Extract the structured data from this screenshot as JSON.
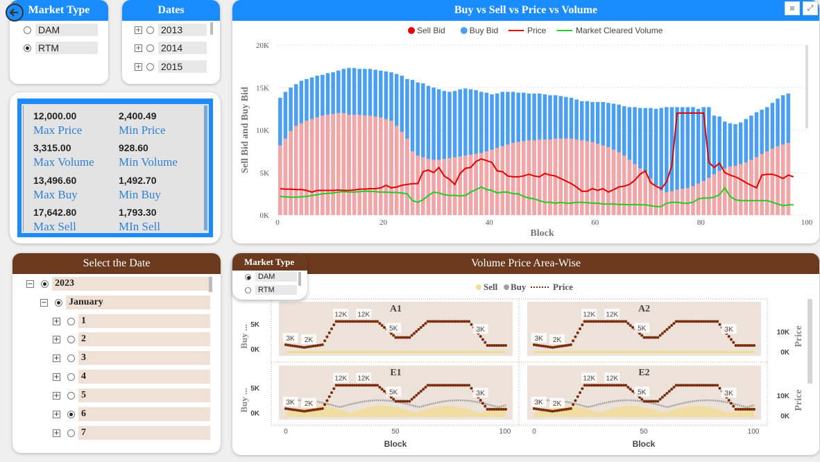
{
  "market_type_slicer": {
    "title": "Market Type",
    "options": [
      {
        "label": "DAM",
        "selected": false
      },
      {
        "label": "RTM",
        "selected": true
      }
    ]
  },
  "dates_slicer": {
    "title": "Dates",
    "options": [
      "2013",
      "2014",
      "2015"
    ]
  },
  "stats": [
    {
      "value": "12,000.00",
      "label": "Max Price"
    },
    {
      "value": "2,400.49",
      "label": "Min Price"
    },
    {
      "value": "3,315.00",
      "label": "Max Volume"
    },
    {
      "value": "928.60",
      "label": "Min Volume"
    },
    {
      "value": "13,496.60",
      "label": "Max Buy"
    },
    {
      "value": "1,492.70",
      "label": "Min Buy"
    },
    {
      "value": "17,642.80",
      "label": "Max Sell"
    },
    {
      "value": "1,793.30",
      "label": "MIn Sell"
    }
  ],
  "select_date": {
    "title": "Select the Date",
    "year": "2023",
    "month": "January",
    "days": [
      {
        "label": "1",
        "selected": false
      },
      {
        "label": "2",
        "selected": false
      },
      {
        "label": "3",
        "selected": false
      },
      {
        "label": "4",
        "selected": false
      },
      {
        "label": "5",
        "selected": false
      },
      {
        "label": "6",
        "selected": true
      },
      {
        "label": "7",
        "selected": false
      }
    ]
  },
  "main_chart_header": {
    "title": "Buy vs Sell vs Price vs Volume"
  },
  "market_type_popup": {
    "title": "Market Type",
    "options": [
      {
        "label": "DAM",
        "selected": true
      },
      {
        "label": "RTM",
        "selected": false
      }
    ]
  },
  "area_chart_header": {
    "title": "Volume Price Area-Wise"
  },
  "colors": {
    "sell": "#f4a6a6",
    "buy": "#4a9ff0",
    "price": "#e00000",
    "volume": "#22cc22",
    "blue_header": "#1a8cff",
    "brown_header": "#6b3a1e",
    "price_dots": "#7a2e10",
    "area_sell": "#efdc95",
    "area_buy": "#a0a0a0"
  },
  "chart_data": [
    {
      "type": "bar",
      "title": "Buy vs Sell vs Price vs Volume",
      "xlabel": "Block",
      "ylabel": "Sell Bid and Buy Bid",
      "xlim": [
        0,
        100
      ],
      "ylim": [
        0,
        20000
      ],
      "x_ticks": [
        "0",
        "20",
        "40",
        "60",
        "80",
        "100"
      ],
      "y_ticks": [
        "0K",
        "5K",
        "10K",
        "15K",
        "20K"
      ],
      "legend": [
        "Sell Bid",
        "Buy Bid",
        "Price",
        "Market Cleared Volume"
      ],
      "legend_position": "top",
      "buy_bid": [
        13800,
        14500,
        15000,
        15400,
        15800,
        16000,
        16200,
        16400,
        16500,
        16700,
        16800,
        17000,
        17200,
        17300,
        17300,
        17200,
        17200,
        17200,
        17100,
        17000,
        16900,
        16800,
        16600,
        16400,
        16000,
        15900,
        15600,
        15500,
        15200,
        15000,
        14800,
        14600,
        14500,
        14600,
        14800,
        14900,
        14800,
        14700,
        14500,
        14400,
        14200,
        14300,
        14500,
        14500,
        14500,
        14400,
        14400,
        14300,
        14300,
        14300,
        14200,
        14100,
        14100,
        14000,
        13900,
        13800,
        13600,
        13400,
        13400,
        13300,
        13300,
        13300,
        13200,
        13100,
        13000,
        12800,
        12700,
        12700,
        12600,
        12600,
        12600,
        12500,
        12600,
        12700,
        12700,
        12700,
        12700,
        12700,
        12700,
        12500,
        12700,
        12700,
        11700,
        11600,
        11000,
        10800,
        10700,
        10900,
        11300,
        11700,
        12100,
        12400,
        12700,
        13200,
        13700,
        14100,
        14300
      ],
      "sell_bid": [
        8200,
        9000,
        9900,
        10500,
        10800,
        11100,
        11300,
        11500,
        11700,
        11800,
        11900,
        12000,
        12000,
        11800,
        11800,
        11800,
        11700,
        11700,
        11600,
        11500,
        11300,
        11100,
        10500,
        9800,
        9000,
        7500,
        7000,
        6800,
        6600,
        6500,
        6500,
        6600,
        6700,
        6800,
        6900,
        7000,
        7100,
        7200,
        7300,
        7500,
        7700,
        7900,
        8100,
        8300,
        8500,
        8600,
        8700,
        8800,
        8800,
        8900,
        8900,
        8900,
        9000,
        9000,
        9000,
        9000,
        8900,
        8800,
        8700,
        8600,
        8400,
        8200,
        8000,
        7700,
        7400,
        7000,
        6500,
        6000,
        5500,
        5000,
        4300,
        3500,
        2900,
        2700,
        2800,
        3000,
        3100,
        3200,
        3400,
        3700,
        4000,
        4400,
        4800,
        5200,
        5500,
        5700,
        5800,
        6000,
        6200,
        6500,
        6800,
        7200,
        7500,
        7800,
        8100,
        8300,
        8500
      ],
      "price": [
        3100,
        3050,
        3050,
        3000,
        3000,
        2900,
        2700,
        2900,
        2900,
        2900,
        2900,
        2950,
        2900,
        2900,
        2950,
        3050,
        3050,
        3100,
        3100,
        3200,
        3500,
        3200,
        3300,
        3500,
        3600,
        3700,
        3700,
        5100,
        5300,
        5000,
        5600,
        4600,
        4200,
        3600,
        4900,
        5500,
        5600,
        6300,
        6600,
        6400,
        6200,
        5200,
        5100,
        4600,
        4500,
        4500,
        4600,
        4800,
        4600,
        4500,
        4900,
        4700,
        4600,
        4300,
        4000,
        3700,
        3300,
        2800,
        2800,
        3100,
        2900,
        3100,
        2700,
        3000,
        3300,
        3400,
        3600,
        4100,
        4800,
        5200,
        3800,
        3400,
        3100,
        3900,
        5800,
        12000,
        12000,
        12000,
        12000,
        12000,
        12000,
        6200,
        5600,
        6100,
        5000,
        4700,
        4500,
        4200,
        3800,
        3500,
        3200,
        4700,
        4800,
        4800,
        4600,
        4300,
        4700,
        4500
      ],
      "market_cleared_volume": [
        2200,
        2150,
        2100,
        2100,
        2150,
        2200,
        2300,
        2400,
        2500,
        2550,
        2600,
        2700,
        2750,
        2700,
        2700,
        2750,
        2800,
        2800,
        2750,
        2700,
        2700,
        2650,
        2650,
        2600,
        2500,
        1700,
        1500,
        1800,
        2300,
        2700,
        2600,
        2400,
        2300,
        2300,
        2250,
        2300,
        2700,
        3000,
        3300,
        3000,
        2900,
        2600,
        2700,
        2700,
        2500,
        2500,
        2200,
        2000,
        1900,
        1700,
        1500,
        1500,
        1400,
        1500,
        1400,
        1400,
        1500,
        1500,
        1450,
        1400,
        1400,
        1300,
        1300,
        1300,
        1250,
        1250,
        1200,
        1250,
        1200,
        1200,
        1100,
        1000,
        1000,
        1400,
        1500,
        1500,
        1400,
        1400,
        1500,
        1900,
        2000,
        2000,
        2100,
        2400,
        3200,
        2200,
        1800,
        1700,
        1700,
        1700,
        1700,
        1700,
        1700,
        1500,
        1300,
        1100,
        1200,
        1200
      ]
    },
    {
      "type": "area",
      "title": "Volume Price Area-Wise",
      "legend": [
        "Sell",
        "Buy",
        "Price"
      ],
      "legend_position": "top",
      "xlabel": "Block",
      "x_ticks": [
        "0",
        "50",
        "100"
      ],
      "left_axis_label": "Buy ...",
      "right_axis_label": "Price",
      "left_ticks": [
        "5K",
        "0K"
      ],
      "right_ticks": [
        "10K",
        "0K"
      ],
      "panels": [
        {
          "name": "A1",
          "price_labels": [
            "3K",
            "2K",
            "12K",
            "12K",
            "5K",
            "3K"
          ]
        },
        {
          "name": "A2",
          "price_labels": [
            "3K",
            "2K",
            "12K",
            "12K",
            "5K",
            "3K"
          ]
        },
        {
          "name": "E1",
          "price_labels": [
            "3K",
            "2K",
            "12K",
            "12K",
            "5K",
            "3K"
          ]
        },
        {
          "name": "E2",
          "price_labels": [
            "3K",
            "2K",
            "12K",
            "12K",
            "5K",
            "3K"
          ]
        }
      ]
    }
  ]
}
